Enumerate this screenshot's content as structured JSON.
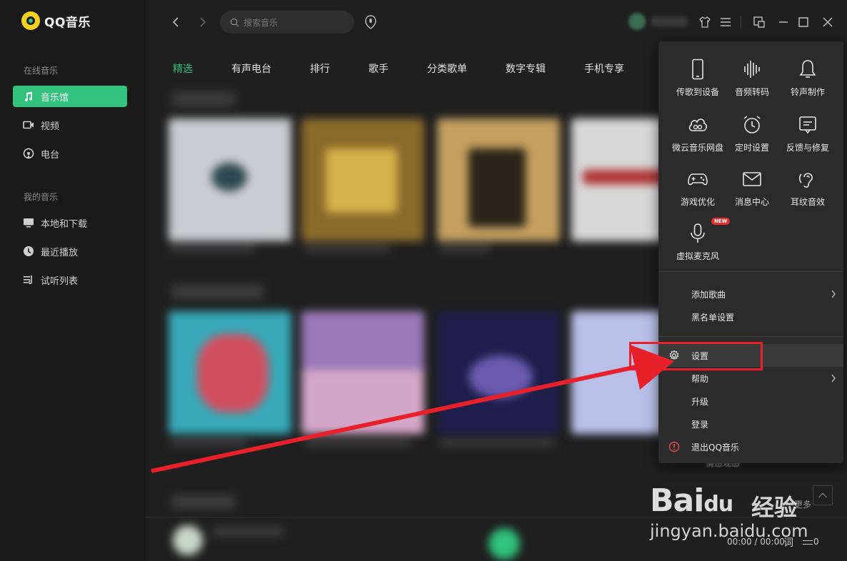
{
  "app": {
    "name": "QQ音乐"
  },
  "sidebar": {
    "group1": "在线音乐",
    "items1": [
      {
        "label": "音乐馆",
        "icon": "music-note-icon",
        "active": true
      },
      {
        "label": "视频",
        "icon": "video-icon"
      },
      {
        "label": "电台",
        "icon": "radio-icon"
      }
    ],
    "group2": "我的音乐",
    "items2": [
      {
        "label": "本地和下载",
        "icon": "monitor-icon"
      },
      {
        "label": "最近播放",
        "icon": "clock-icon"
      },
      {
        "label": "试听列表",
        "icon": "playlist-icon"
      }
    ]
  },
  "search": {
    "placeholder": "搜索音乐"
  },
  "tabs": [
    "精选",
    "有声电台",
    "排行",
    "歌手",
    "分类歌单",
    "数字专辑",
    "手机专享"
  ],
  "menu": {
    "grid": [
      {
        "label": "传歌到设备",
        "icon": "phone-icon"
      },
      {
        "label": "音频转码",
        "icon": "waveform-icon"
      },
      {
        "label": "铃声制作",
        "icon": "bell-icon"
      },
      {
        "label": "微云音乐网盘",
        "icon": "cloud-icon"
      },
      {
        "label": "定时设置",
        "icon": "alarm-icon"
      },
      {
        "label": "反馈与修复",
        "icon": "feedback-icon"
      },
      {
        "label": "游戏优化",
        "icon": "gamepad-icon"
      },
      {
        "label": "消息中心",
        "icon": "mail-icon"
      },
      {
        "label": "耳纹音效",
        "icon": "ear-icon"
      },
      {
        "label": "虚拟麦克风",
        "icon": "microphone-icon",
        "badge": "NEW"
      }
    ],
    "rows": [
      {
        "label": "添加歌曲",
        "chevron": true
      },
      {
        "label": "黑名单设置"
      },
      {
        "label": "设置",
        "icon": "gear-icon",
        "highlight": true
      },
      {
        "label": "帮助",
        "chevron": true
      },
      {
        "label": "升级"
      },
      {
        "label": "登录"
      },
      {
        "label": "退出QQ音乐",
        "icon": "warning-icon"
      }
    ]
  },
  "player": {
    "time": "00:00 / 00:00",
    "lyric": "词",
    "queue_count": "0"
  },
  "peek": {
    "more": "更多",
    "text": "情感观感"
  },
  "watermark": {
    "logo": "Bai",
    "logo2": "du",
    "brand": "经验",
    "url": "jingyan.baidu.com"
  },
  "colors": {
    "accent": "#31c27c",
    "annotation": "#e8202a",
    "menu_bg": "#2b2b2b"
  }
}
